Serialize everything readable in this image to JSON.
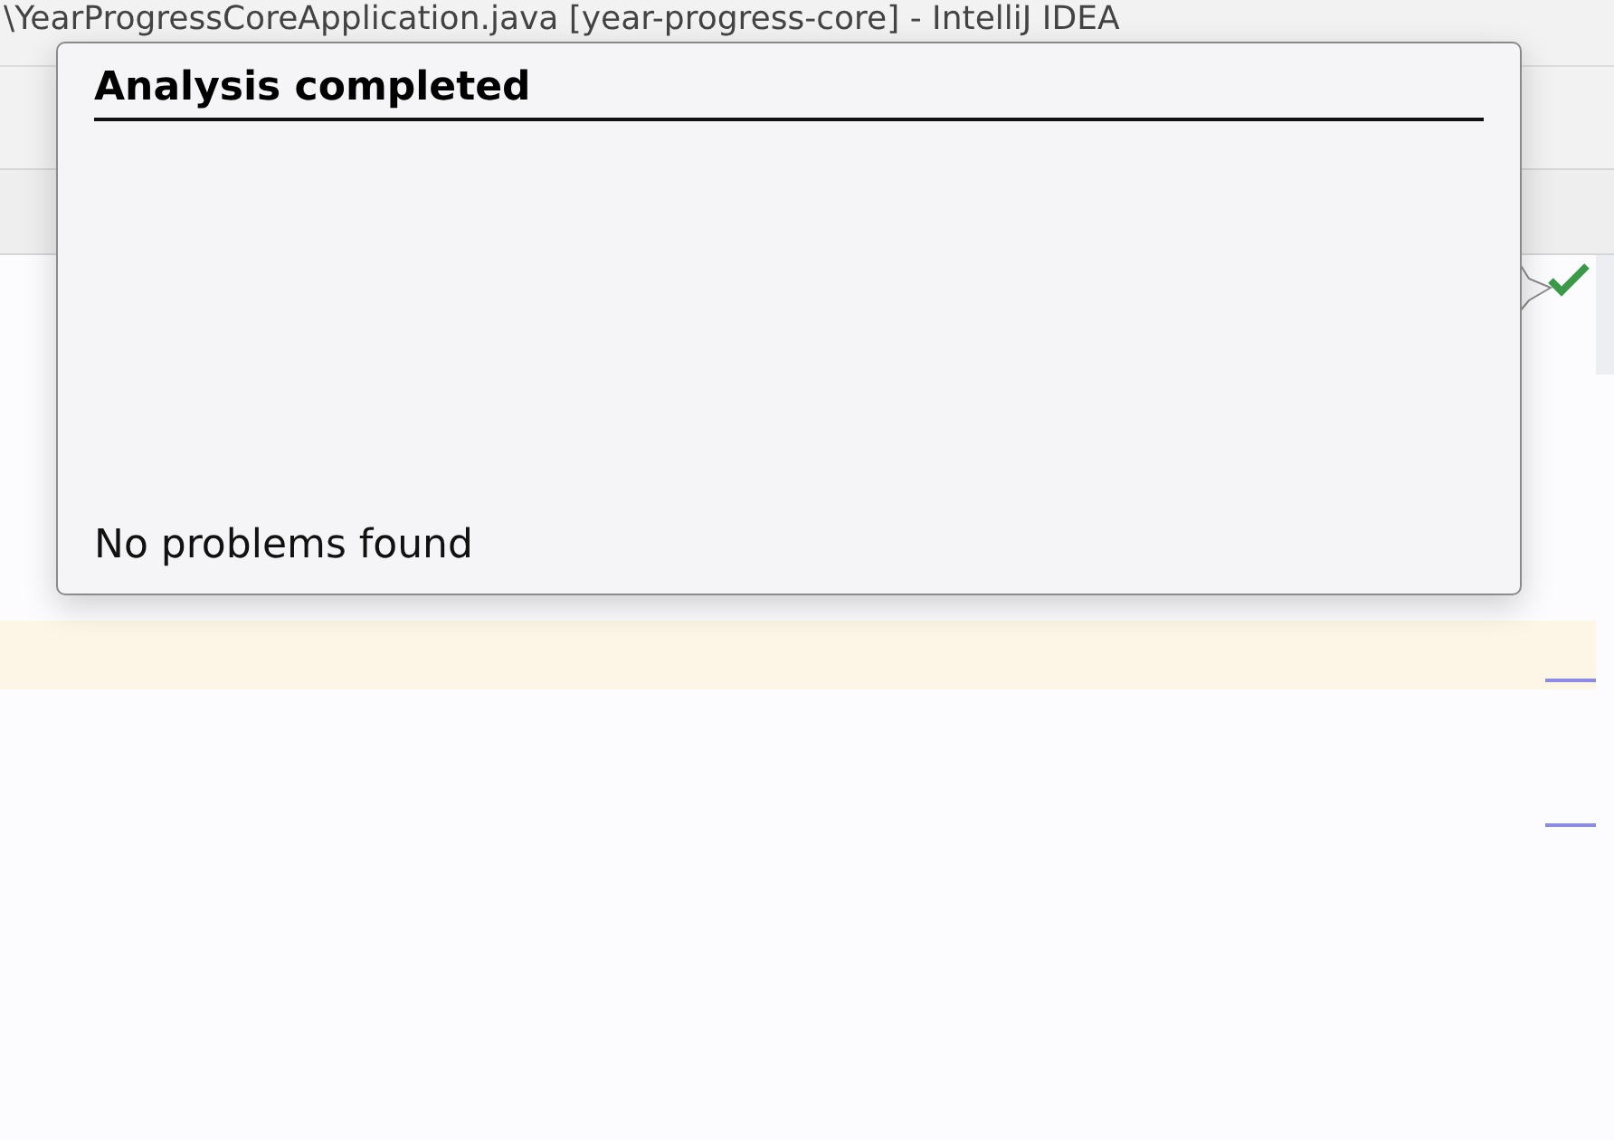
{
  "window": {
    "title": "\\YearProgressCoreApplication.java [year-progress-core] - IntelliJ IDEA"
  },
  "popup": {
    "title": "Analysis completed",
    "message": "No problems found"
  }
}
